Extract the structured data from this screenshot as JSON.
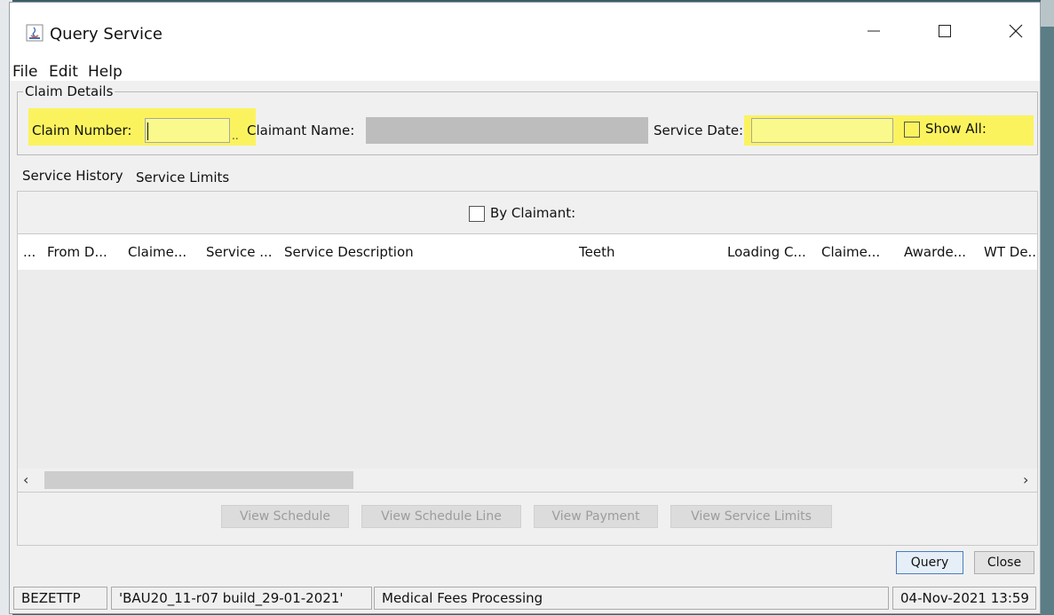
{
  "window": {
    "title": "Query Service"
  },
  "menu": [
    "File",
    "Edit",
    "Help"
  ],
  "claim_details": {
    "legend": "Claim Details",
    "claim_number_label": "Claim Number:",
    "claim_number_value": "",
    "lookup_button": "..",
    "claimant_name_label": "Claimant Name:",
    "claimant_name_value": "",
    "service_date_label": "Service Date:",
    "service_date_value": "",
    "show_all_label": "Show All:",
    "highlight_color": "#fbf35e"
  },
  "tabs": [
    {
      "label": "Service History",
      "active": true
    },
    {
      "label": "Service Limits",
      "active": false
    }
  ],
  "by_claimant_label": "By Claimant:",
  "table": {
    "columns": [
      "...",
      "From D...",
      "Claime...",
      "Service ...",
      "Service Description",
      "Teeth",
      "Loading C...",
      "Claime...",
      "Awarde...",
      "WT De.."
    ],
    "rows": []
  },
  "action_buttons": {
    "view_schedule": "View Schedule",
    "view_schedule_line": "View Schedule Line",
    "view_payment": "View Payment",
    "view_service_limits": "View Service Limits"
  },
  "dialog_buttons": {
    "query": "Query",
    "close": "Close"
  },
  "status": {
    "user": "BEZETTP",
    "build": "'BAU20_11-r07 build_29-01-2021'",
    "module": "Medical Fees Processing",
    "datetime": "04-Nov-2021 13:59"
  }
}
